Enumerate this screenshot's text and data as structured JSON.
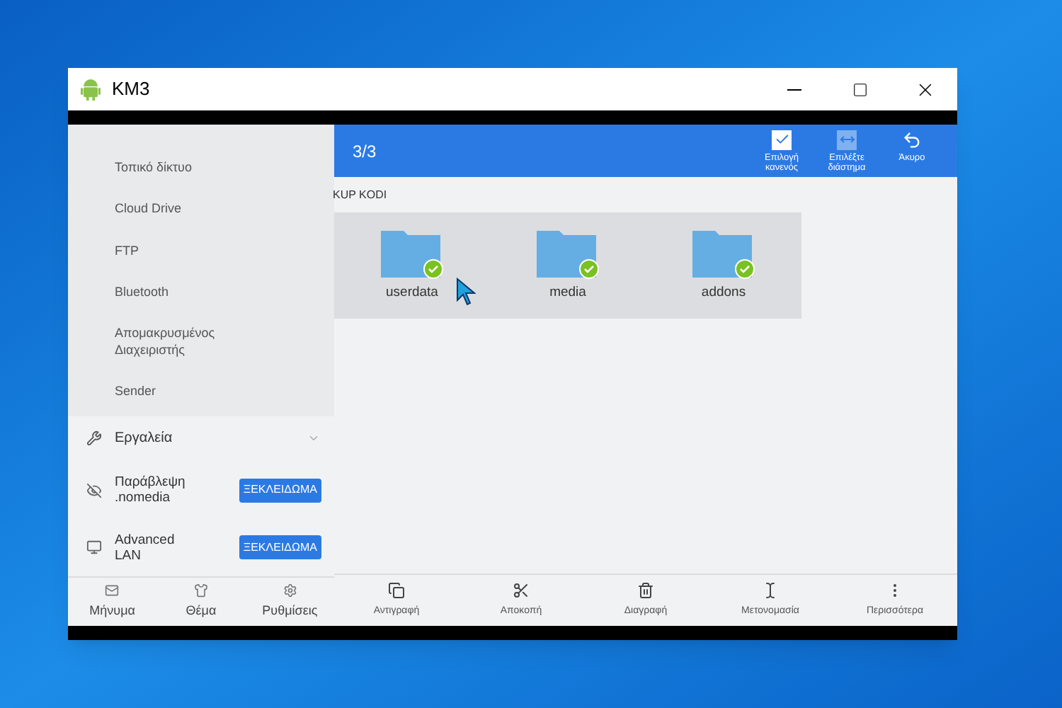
{
  "window": {
    "title": "KM3"
  },
  "sidebar": {
    "network_items": [
      "Τοπικό δίκτυο",
      "Cloud Drive",
      "FTP",
      "Bluetooth",
      "Απομακρυσμένος Διαχειριστής",
      "Sender"
    ],
    "tools": {
      "label": "Εργαλεία",
      "expanded": true
    },
    "tool_rows": [
      {
        "kind": "hidden",
        "label": "Παράβλεψη .nomedia",
        "button": "ΞΕΚΛΕΙΔΩΜΑ"
      },
      {
        "kind": "lan",
        "label": "Advanced LAN",
        "button": "ΞΕΚΛΕΙΔΩΜΑ"
      }
    ],
    "bottom_nav": [
      {
        "kind": "mail",
        "label": "Μήνυμα"
      },
      {
        "kind": "shirt",
        "label": "Θέμα"
      },
      {
        "kind": "gear",
        "label": "Ρυθμίσεις"
      }
    ]
  },
  "header": {
    "count": "3/3",
    "actions": [
      {
        "kind": "check",
        "label": "Επιλογή κανενός"
      },
      {
        "kind": "range",
        "label": "Επιλέξτε διάστημα"
      },
      {
        "kind": "undo",
        "label": "Άκυρο"
      }
    ]
  },
  "breadcrumb": "KUP KODI",
  "folders": [
    {
      "name": "userdata",
      "selected": true
    },
    {
      "name": "media",
      "selected": true
    },
    {
      "name": "addons",
      "selected": true
    }
  ],
  "toolbar": [
    {
      "kind": "copy",
      "label": "Αντιγραφή"
    },
    {
      "kind": "cut",
      "label": "Αποκοπή"
    },
    {
      "kind": "delete",
      "label": "Διαγραφή"
    },
    {
      "kind": "rename",
      "label": "Μετονομασία"
    },
    {
      "kind": "more",
      "label": "Περισσότερα"
    }
  ]
}
